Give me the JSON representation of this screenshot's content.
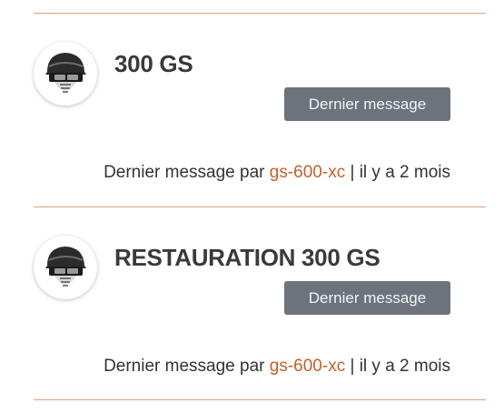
{
  "topics": [
    {
      "title": "300 GS",
      "button_label": "Dernier message",
      "last_prefix": "Dernier message par",
      "last_user": "gs-600-xc",
      "last_sep": "|",
      "last_time": "il y a 2 mois",
      "avatar_icon": "helmet-icon"
    },
    {
      "title": "RESTAURATION 300 GS",
      "button_label": "Dernier message",
      "last_prefix": "Dernier message par",
      "last_user": "gs-600-xc",
      "last_sep": "|",
      "last_time": "il y a 2 mois",
      "avatar_icon": "helmet-icon"
    }
  ],
  "colors": {
    "divider": "#e0a27a",
    "button_bg": "#6c737c",
    "link": "#c4602b",
    "title": "#3a3a3a"
  }
}
